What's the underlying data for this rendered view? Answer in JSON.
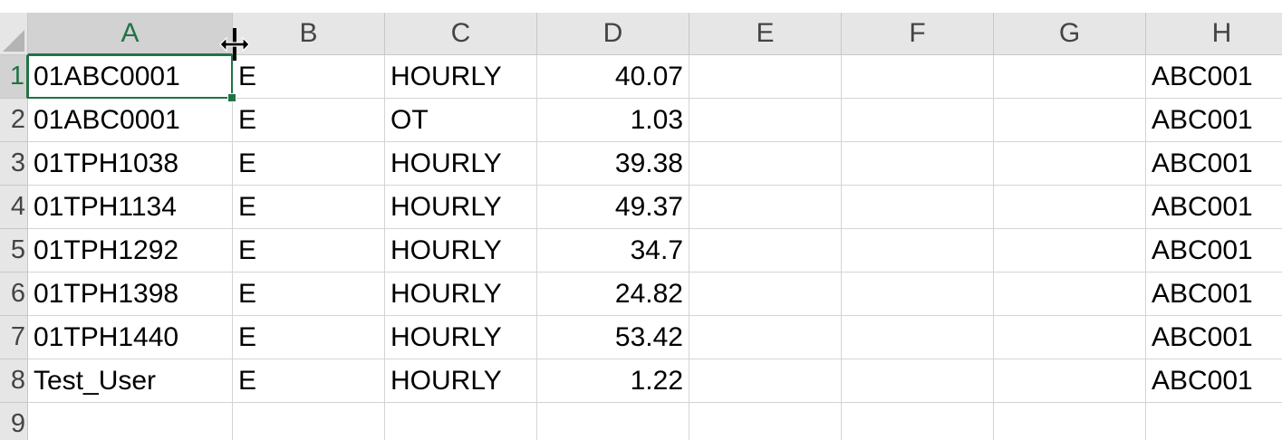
{
  "columns": [
    "A",
    "B",
    "C",
    "D",
    "E",
    "F",
    "G",
    "H"
  ],
  "selected_column": "A",
  "row_headers": [
    "1",
    "2",
    "3",
    "4",
    "5",
    "6",
    "7",
    "8",
    "9"
  ],
  "active_cell": "A1",
  "rows": [
    {
      "A": "01ABC0001",
      "B": "E",
      "C": "HOURLY",
      "D": "40.07",
      "E": "",
      "F": "",
      "G": "",
      "H": "ABC001"
    },
    {
      "A": "01ABC0001",
      "B": "E",
      "C": "OT",
      "D": "1.03",
      "E": "",
      "F": "",
      "G": "",
      "H": "ABC001"
    },
    {
      "A": "01TPH1038",
      "B": "E",
      "C": "HOURLY",
      "D": "39.38",
      "E": "",
      "F": "",
      "G": "",
      "H": "ABC001"
    },
    {
      "A": "01TPH1134",
      "B": "E",
      "C": "HOURLY",
      "D": "49.37",
      "E": "",
      "F": "",
      "G": "",
      "H": "ABC001"
    },
    {
      "A": "01TPH1292",
      "B": "E",
      "C": "HOURLY",
      "D": "34.7",
      "E": "",
      "F": "",
      "G": "",
      "H": "ABC001"
    },
    {
      "A": "01TPH1398",
      "B": "E",
      "C": "HOURLY",
      "D": "24.82",
      "E": "",
      "F": "",
      "G": "",
      "H": "ABC001"
    },
    {
      "A": "01TPH1440",
      "B": "E",
      "C": "HOURLY",
      "D": "53.42",
      "E": "",
      "F": "",
      "G": "",
      "H": "ABC001"
    },
    {
      "A": "Test_User",
      "B": "E",
      "C": "HOURLY",
      "D": "1.22",
      "E": "",
      "F": "",
      "G": "",
      "H": "ABC001"
    },
    {
      "A": "",
      "B": "",
      "C": "",
      "D": "",
      "E": "",
      "F": "",
      "G": "",
      "H": ""
    }
  ],
  "numeric_columns": [
    "D"
  ],
  "cursor_icon": "column-resize-cursor-icon",
  "colors": {
    "accent": "#217346",
    "header_bg": "#e6e6e6",
    "header_selected_bg": "#d2d2d2",
    "gridline": "#d4d4d4"
  }
}
